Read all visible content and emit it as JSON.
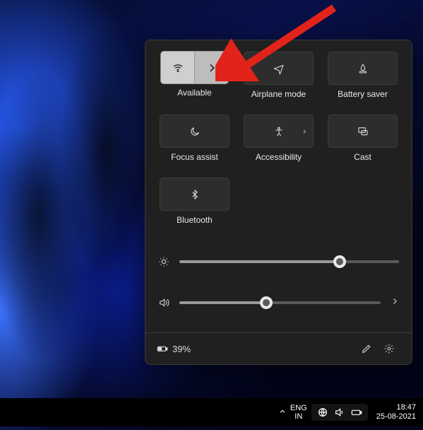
{
  "tiles": {
    "wifi": {
      "label": "Available"
    },
    "airplane": {
      "label": "Airplane mode"
    },
    "battery_saver": {
      "label": "Battery saver"
    },
    "focus": {
      "label": "Focus assist"
    },
    "accessibility": {
      "label": "Accessibility"
    },
    "cast": {
      "label": "Cast"
    },
    "bluetooth": {
      "label": "Bluetooth"
    }
  },
  "sliders": {
    "brightness": {
      "value": 73
    },
    "volume": {
      "value": 43
    }
  },
  "footer": {
    "battery_text": "39%"
  },
  "taskbar": {
    "lang_top": "ENG",
    "lang_bottom": "IN",
    "time": "18:47",
    "date": "25-08-2021"
  }
}
